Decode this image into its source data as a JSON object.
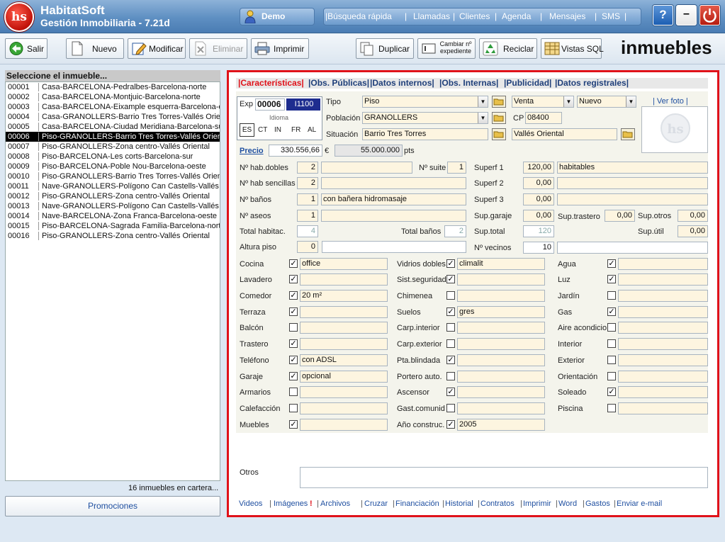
{
  "header": {
    "app_name": "HabitatSoft",
    "app_subtitle": "Gestión Inmobiliaria - 7.21d",
    "logo_text": "hs",
    "user_label": "Demo",
    "nav": [
      "|Búsqueda rápida",
      "|",
      "Llamadas",
      "|",
      "Clientes",
      "|",
      "Agenda",
      "|",
      "Mensajes",
      "|",
      "SMS",
      "|"
    ],
    "help_label": "?",
    "min_label": "–"
  },
  "toolbar": {
    "salir": "Salir",
    "nuevo": "Nuevo",
    "modificar": "Modificar",
    "eliminar": "Eliminar",
    "imprimir": "Imprimir",
    "duplicar": "Duplicar",
    "cambiar_1": "Cambiar nº",
    "cambiar_2": "expediente",
    "reciclar": "Reciclar",
    "vistas": "Vistas SQL",
    "title": "inmuebles"
  },
  "list": {
    "header": "Seleccione el inmueble...",
    "rows": [
      {
        "code": "00001",
        "desc": "Casa-BARCELONA-Pedralbes-Barcelona-norte"
      },
      {
        "code": "00002",
        "desc": "Casa-BARCELONA-Montjuic-Barcelona-norte"
      },
      {
        "code": "00003",
        "desc": "Casa-BARCELONA-Eixample esquerra-Barcelona-est"
      },
      {
        "code": "00004",
        "desc": "Casa-GRANOLLERS-Barrio Tres Torres-Vallés Oriental"
      },
      {
        "code": "00005",
        "desc": "Casa-BARCELONA-Ciudad Meridiana-Barcelona-sur"
      },
      {
        "code": "00006",
        "desc": "Piso-GRANOLLERS-Barrio Tres Torres-Vallés Oriental"
      },
      {
        "code": "00007",
        "desc": "Piso-GRANOLLERS-Zona centro-Vallés Oriental"
      },
      {
        "code": "00008",
        "desc": "Piso-BARCELONA-Les corts-Barcelona-sur"
      },
      {
        "code": "00009",
        "desc": "Piso-BARCELONA-Poble Nou-Barcelona-oeste"
      },
      {
        "code": "00010",
        "desc": "Piso-GRANOLLERS-Barrio Tres Torres-Vallés Oriental"
      },
      {
        "code": "00011",
        "desc": "Nave-GRANOLLERS-Polígono Can Castells-Vallés Oriental"
      },
      {
        "code": "00012",
        "desc": "Piso-GRANOLLERS-Zona centro-Vallés Oriental"
      },
      {
        "code": "00013",
        "desc": "Nave-GRANOLLERS-Polígono Can Castells-Vallés Oriental"
      },
      {
        "code": "00014",
        "desc": "Nave-BARCELONA-Zona Franca-Barcelona-oeste"
      },
      {
        "code": "00015",
        "desc": "Piso-BARCELONA-Sagrada Familia-Barcelona-norte"
      },
      {
        "code": "00016",
        "desc": "Piso-GRANOLLERS-Zona centro-Vallés Oriental"
      }
    ],
    "selected_index": 5,
    "count": "16 inmuebles en cartera...",
    "promociones": "Promociones"
  },
  "tabs": [
    "|Características|",
    "|Obs. Públicas|",
    "|Datos internos|",
    "|Obs. Internas|",
    "|Publicidad|",
    "|Datos registrales|"
  ],
  "form": {
    "exp_label": "Exp",
    "exp_value": "00006",
    "ref_value": "I1100",
    "idioma_label": "Idioma",
    "languages": [
      "ES",
      "CT",
      "IN",
      "FR",
      "AL"
    ],
    "tipo_label": "Tipo",
    "tipo": "Piso",
    "poblacion_label": "Población",
    "poblacion": "GRANOLLERS",
    "situacion_label": "Situación",
    "situacion": "Barrio Tres Torres",
    "operacion": "Venta",
    "estado": "Nuevo",
    "cp_label": "CP",
    "cp": "08400",
    "zona": "Vallés Oriental",
    "ver_foto": "Ver foto",
    "precio_label": "Precio",
    "precio_eur": "330.556,66",
    "eur_symbol": "€",
    "precio_pts": "55.000.000",
    "pts_label": "pts",
    "hab_dobles_label": "Nº hab.dobles",
    "hab_dobles": "2",
    "suite_label": "Nº suite",
    "suite": "1",
    "hab_sencillas_label": "Nº hab sencillas",
    "hab_sencillas": "2",
    "banos_label": "Nº baños",
    "banos": "1",
    "banos_desc": "con bañera hidromasaje",
    "aseos_label": "Nº aseos",
    "aseos": "1",
    "total_hab_label": "Total habitac.",
    "total_hab": "4",
    "total_banos_label": "Total baños",
    "total_banos": "2",
    "altura_label": "Altura piso",
    "altura": "0",
    "superf1_label": "Superf 1",
    "superf1": "120,00",
    "superf1_desc": "habitables",
    "superf2_label": "Superf 2",
    "superf2": "0,00",
    "superf3_label": "Superf 3",
    "superf3": "0,00",
    "garaje_s_label": "Sup.garaje",
    "garaje_s": "0,00",
    "trastero_s_label": "Sup.trastero",
    "trastero_s": "0,00",
    "otros_s_label": "Sup.otros",
    "otros_s": "0,00",
    "total_s_label": "Sup.total",
    "total_s": "120",
    "util_s_label": "Sup.útil",
    "util_s": "0,00",
    "vecinos_label": "Nº vecinos",
    "vecinos": "10",
    "check_mark": "✓",
    "features_col1": [
      {
        "label": "Cocina",
        "checked": true,
        "value": "office"
      },
      {
        "label": "Lavadero",
        "checked": true,
        "value": ""
      },
      {
        "label": "Comedor",
        "checked": true,
        "value": "20 m²"
      },
      {
        "label": "Terraza",
        "checked": true,
        "value": ""
      },
      {
        "label": "Balcón",
        "checked": false,
        "value": ""
      },
      {
        "label": "Trastero",
        "checked": true,
        "value": ""
      },
      {
        "label": "Teléfono",
        "checked": true,
        "value": "con ADSL"
      },
      {
        "label": "Garaje",
        "checked": true,
        "value": "opcional"
      },
      {
        "label": "Armarios",
        "checked": false,
        "value": ""
      },
      {
        "label": "Calefacción",
        "checked": false,
        "value": ""
      },
      {
        "label": "Muebles",
        "checked": true,
        "value": ""
      }
    ],
    "features_col2": [
      {
        "label": "Vidrios dobles",
        "checked": true,
        "value": "climalit"
      },
      {
        "label": "Sist.seguridad",
        "checked": true,
        "value": ""
      },
      {
        "label": "Chimenea",
        "checked": false,
        "value": ""
      },
      {
        "label": "Suelos",
        "checked": true,
        "value": "gres"
      },
      {
        "label": "Carp.interior",
        "checked": false,
        "value": ""
      },
      {
        "label": "Carp.exterior",
        "checked": false,
        "value": ""
      },
      {
        "label": "Pta.blindada",
        "checked": true,
        "value": ""
      },
      {
        "label": "Portero auto.",
        "checked": false,
        "value": ""
      },
      {
        "label": "Ascensor",
        "checked": true,
        "value": ""
      },
      {
        "label": "Gast.comunid",
        "checked": false,
        "value": ""
      },
      {
        "label": "Año construc.",
        "checked": true,
        "value": "2005"
      }
    ],
    "features_col3": [
      {
        "label": "Agua",
        "checked": true,
        "value": ""
      },
      {
        "label": "Luz",
        "checked": true,
        "value": ""
      },
      {
        "label": "Jardín",
        "checked": false,
        "value": ""
      },
      {
        "label": "Gas",
        "checked": true,
        "value": ""
      },
      {
        "label": "Aire acondicio",
        "checked": false,
        "value": ""
      },
      {
        "label": "Interior",
        "checked": false,
        "value": ""
      },
      {
        "label": "Exterior",
        "checked": false,
        "value": ""
      },
      {
        "label": "Orientación",
        "checked": false,
        "value": ""
      },
      {
        "label": "Soleado",
        "checked": true,
        "value": ""
      },
      {
        "label": "Piscina",
        "checked": false,
        "value": ""
      }
    ],
    "otros_label": "Otros",
    "otros": ""
  },
  "bottom_links": [
    "Videos",
    "|",
    "Imágenes",
    "!",
    "|",
    "Archivos",
    "|",
    "Cruzar",
    "|",
    "Financiación",
    "|",
    "Historial",
    "|",
    "Contratos",
    "|",
    "Imprimir",
    "|",
    "Word",
    "|",
    "Gastos",
    "|",
    "Enviar e-mail"
  ],
  "colors": {
    "accent_red": "#e0121a",
    "link_blue": "#1f4fa0",
    "field_bg": "#fdf5e0",
    "header_blue": "#5e8fc2"
  }
}
